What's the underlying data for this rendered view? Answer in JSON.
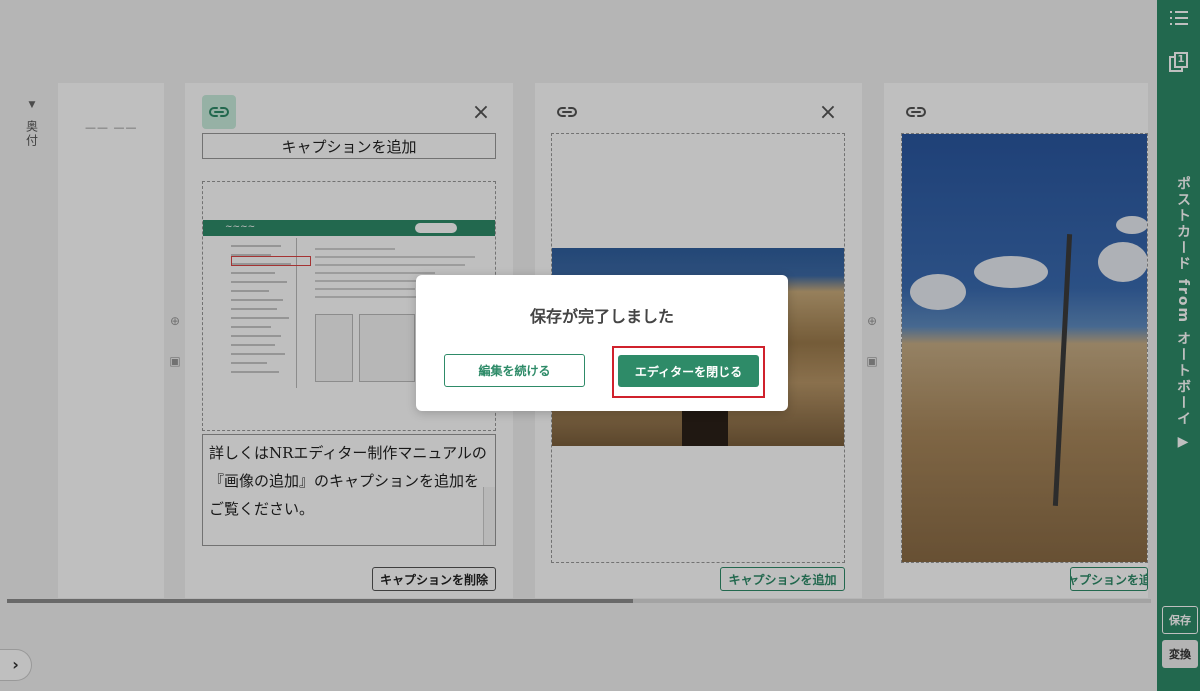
{
  "colors": {
    "brand_green": "#2e8b68",
    "highlight_red": "#d0212c",
    "overlay": "rgba(0,0,0,0.25)"
  },
  "left_rail": {
    "label": "奥付"
  },
  "pages": [
    {
      "caption_title": "キャプションを追加",
      "caption_text": "詳しくはNRエディター制作マニュアルの『画像の追加』のキャプションを追加をご覧ください。",
      "caption_button": "キャプションを削除"
    },
    {
      "caption_button": "キャプションを追加"
    },
    {
      "caption_button": "キャプションを追加"
    }
  ],
  "right_rail": {
    "page_count": "1",
    "title": "ポストカード from オートボーイ ▶",
    "save_label": "保存",
    "convert_label": "変換"
  },
  "modal": {
    "title": "保存が完了しました",
    "continue_label": "編集を続ける",
    "close_editor_label": "エディターを閉じる"
  },
  "icons": [
    "link-icon",
    "close-icon",
    "plus-circle-icon",
    "image-icon",
    "list-icon",
    "pages-icon",
    "chevron-right-icon"
  ]
}
